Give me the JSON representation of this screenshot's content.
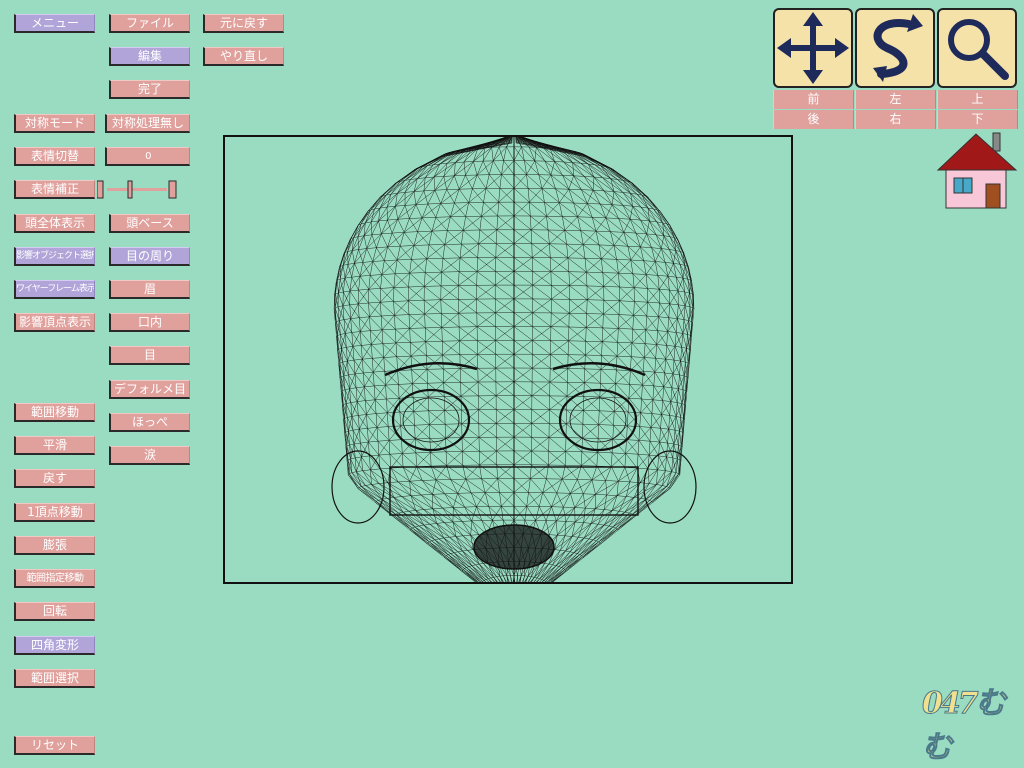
{
  "menu": {
    "menu_label": "メニュー",
    "file_label": "ファイル",
    "undo_label": "元に戻す",
    "edit_label": "編集",
    "redo_label": "やり直し",
    "done_label": "完了"
  },
  "left_controls": {
    "symmetry_mode": "対称モード",
    "symmetry_value": "対称処理無し",
    "expression_switch": "表情切替",
    "expression_value": "0",
    "expression_correct": "表情補正",
    "show_whole_head": "頭全体表示",
    "head_base": "頭ベース",
    "influence_object_select": "影響オブジェクト選択",
    "around_eyes": "目の周り",
    "wireframe_display": "ワイヤーフレーム表示",
    "eyebrows": "眉",
    "influence_vertex_display": "影響頂点表示",
    "mouth_inside": "口内",
    "eyes": "目",
    "deformed_eyes": "デフォルメ目",
    "cheeks": "ほっぺ",
    "tears": "涙"
  },
  "tools": {
    "range_move": "範囲移動",
    "smooth": "平滑",
    "restore": "戻す",
    "single_vertex_move": "1頂点移動",
    "inflate": "膨張",
    "range_specified_move": "範囲指定移動",
    "rotate": "回転",
    "quad_transform": "四角変形",
    "range_select": "範囲選択",
    "reset": "リセット"
  },
  "view": {
    "icons": [
      "move-icon",
      "rotate-icon",
      "zoom-icon"
    ],
    "front": "前",
    "left": "左",
    "top": "上",
    "back": "後",
    "right": "右",
    "bottom": "下"
  },
  "home_icon": "home-icon",
  "logo_text": "047むむ",
  "colors": {
    "background": "#9adcc2",
    "button": "#e0a09c",
    "button_active": "#b0a4d8",
    "nav_button": "#f4e2a8",
    "nav_icon": "#1e2a5a",
    "roof": "#a01818"
  },
  "expression_slider_fraction": 0.35
}
